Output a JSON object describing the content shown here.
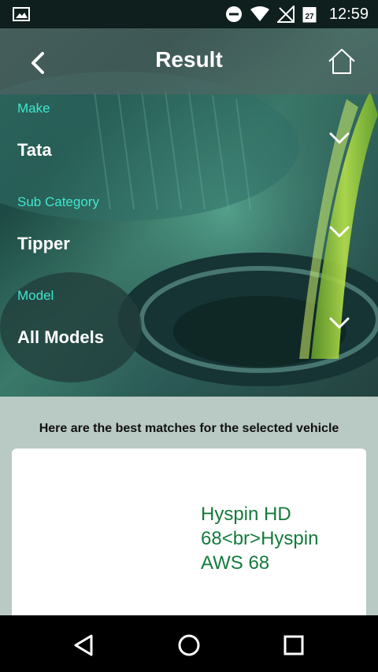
{
  "status_bar": {
    "time": "12:59",
    "calendar_day": "27",
    "icons": [
      "image-icon",
      "do-not-disturb-icon",
      "wifi-icon",
      "no-signal-icon",
      "calendar-icon"
    ]
  },
  "header": {
    "title": "Result",
    "back_icon": "chevron-left-icon",
    "home_icon": "home-icon"
  },
  "fields": [
    {
      "label": "Make",
      "value": "Tata"
    },
    {
      "label": "Sub Category",
      "value": "Tipper"
    },
    {
      "label": "Model",
      "value": "All Models"
    }
  ],
  "matches_text": "Here are the best matches for the selected vehicle",
  "results": [
    {
      "product_name": "Hyspin HD 68<br>Hyspin AWS 68"
    }
  ],
  "colors": {
    "accent_label": "#3fe6cf",
    "product_text": "#157a3c",
    "page_bg": "#b9c9c3"
  },
  "nav_bar": {
    "icons": [
      "back-triangle-icon",
      "home-circle-icon",
      "recents-square-icon"
    ]
  }
}
